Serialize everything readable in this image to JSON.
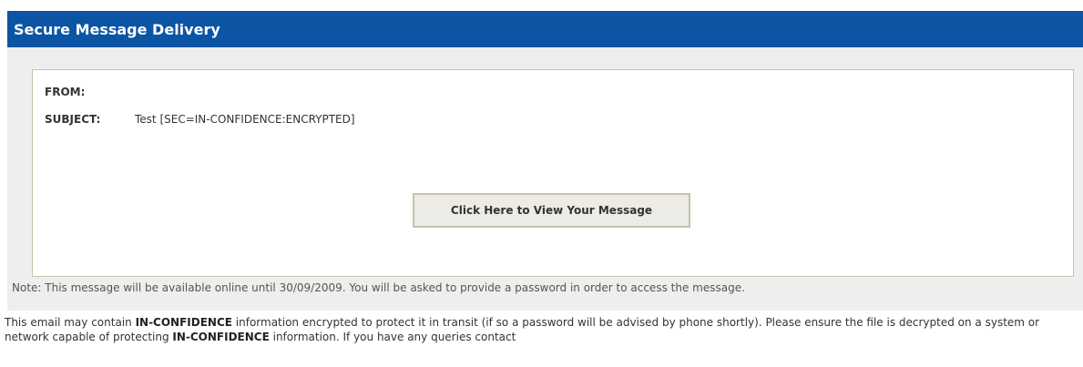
{
  "header": {
    "title": "Secure Message Delivery"
  },
  "message": {
    "from_label": "FROM:",
    "from_value": "",
    "subject_label": "SUBJECT:",
    "subject_value": "Test [SEC=IN-CONFIDENCE:ENCRYPTED]",
    "view_button_label": "Click Here to View Your Message"
  },
  "note": {
    "text": "Note: This message will be available online until 30/09/2009. You will be asked to provide a password in order to access the message."
  },
  "disclaimer": {
    "part1": "This email may contain ",
    "bold1": "IN-CONFIDENCE",
    "part2": " information encrypted to protect it in transit (if so a password will be advised by phone shortly). Please ensure the file is decrypted on a system or network capable of protecting ",
    "bold2": "IN-CONFIDENCE",
    "part3": " information. If you have any queries contact"
  },
  "colors": {
    "header_bg": "#0b55a4",
    "panel_bg": "#eeeeee",
    "box_border": "#c9c3ab",
    "button_bg": "#ecebe6"
  }
}
